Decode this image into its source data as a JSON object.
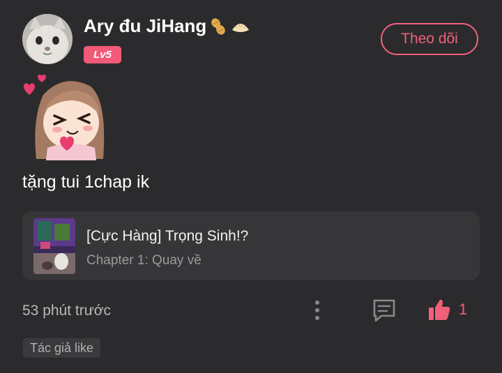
{
  "user": {
    "name": "Ary đu JiHang",
    "name_emojis": [
      "peanut-icon",
      "dumpling-icon"
    ],
    "level": "Lv5"
  },
  "follow_button": {
    "label": "Theo dõi"
  },
  "comment": {
    "text": "tặng tui 1chap ik"
  },
  "chapter_card": {
    "title": "[Cực Hàng] Trọng Sinh!?",
    "subtitle": "Chapter 1: Quay về"
  },
  "footer": {
    "time": "53 phút trước",
    "like_count": "1",
    "author_badge": "Tác giả like"
  },
  "colors": {
    "background": "#2b2b2d",
    "accent": "#f0607a",
    "card": "#363638"
  }
}
